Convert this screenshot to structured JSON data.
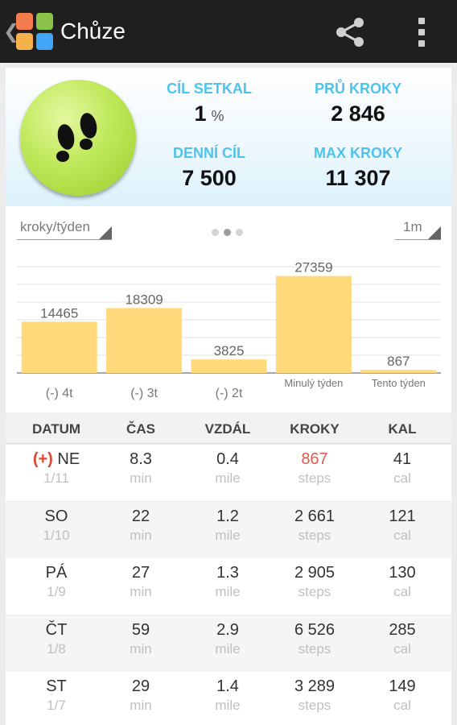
{
  "app": {
    "title": "Chůze",
    "back_icon": "chevron-left-icon",
    "share_icon": "share-icon",
    "menu_icon": "overflow-menu-icon",
    "icon_colors": [
      "#f57c4c",
      "#8bc34a",
      "#f5b14c",
      "#42a5f5"
    ]
  },
  "summary": {
    "badge_icon": "footprints-icon",
    "goal_met": {
      "label": "CÍL  SETKAL",
      "value": "1",
      "unit": "%"
    },
    "avg_steps": {
      "label": "PRŮ KROKY",
      "value": "2 846"
    },
    "daily_goal": {
      "label": "DENNÍ  CÍL",
      "value": "7 500"
    },
    "max_steps": {
      "label": "MAX KROKY",
      "value": "11 307"
    }
  },
  "chart_controls": {
    "metric_select": "kroky/týden",
    "range_select": "1m",
    "page_dots": 3,
    "active_dot": 1
  },
  "chart_data": {
    "type": "bar",
    "categories": [
      "(-) 4t",
      "(-) 3t",
      "(-) 2t",
      "Minulý týden",
      "Tento týden"
    ],
    "values": [
      14465,
      18309,
      3825,
      27359,
      867
    ],
    "value_labels": [
      "14465",
      "18309",
      "3825",
      "27359",
      "867"
    ],
    "ylim": [
      0,
      30000
    ],
    "grid": true,
    "bar_color": "#ffd97a"
  },
  "table": {
    "headers": [
      "DATUM",
      "ČAS",
      "VZDÁL",
      "KROKY",
      "KAL"
    ],
    "rows": [
      {
        "prefix": "(+)",
        "day": "NE",
        "date": "1/11",
        "time": "8.3",
        "time_unit": "min",
        "dist": "0.4",
        "dist_unit": "mile",
        "steps": "867",
        "steps_unit": "steps",
        "cal": "41",
        "cal_unit": "cal"
      },
      {
        "prefix": "",
        "day": "SO",
        "date": "1/10",
        "time": "22",
        "time_unit": "min",
        "dist": "1.2",
        "dist_unit": "mile",
        "steps": "2 661",
        "steps_unit": "steps",
        "cal": "121",
        "cal_unit": "cal"
      },
      {
        "prefix": "",
        "day": "PÁ",
        "date": "1/9",
        "time": "27",
        "time_unit": "min",
        "dist": "1.3",
        "dist_unit": "mile",
        "steps": "2 905",
        "steps_unit": "steps",
        "cal": "130",
        "cal_unit": "cal"
      },
      {
        "prefix": "",
        "day": "ČT",
        "date": "1/8",
        "time": "59",
        "time_unit": "min",
        "dist": "2.9",
        "dist_unit": "mile",
        "steps": "6 526",
        "steps_unit": "steps",
        "cal": "285",
        "cal_unit": "cal"
      },
      {
        "prefix": "",
        "day": "ST",
        "date": "1/7",
        "time": "29",
        "time_unit": "min",
        "dist": "1.4",
        "dist_unit": "mile",
        "steps": "3 289",
        "steps_unit": "steps",
        "cal": "149",
        "cal_unit": "cal"
      }
    ]
  }
}
